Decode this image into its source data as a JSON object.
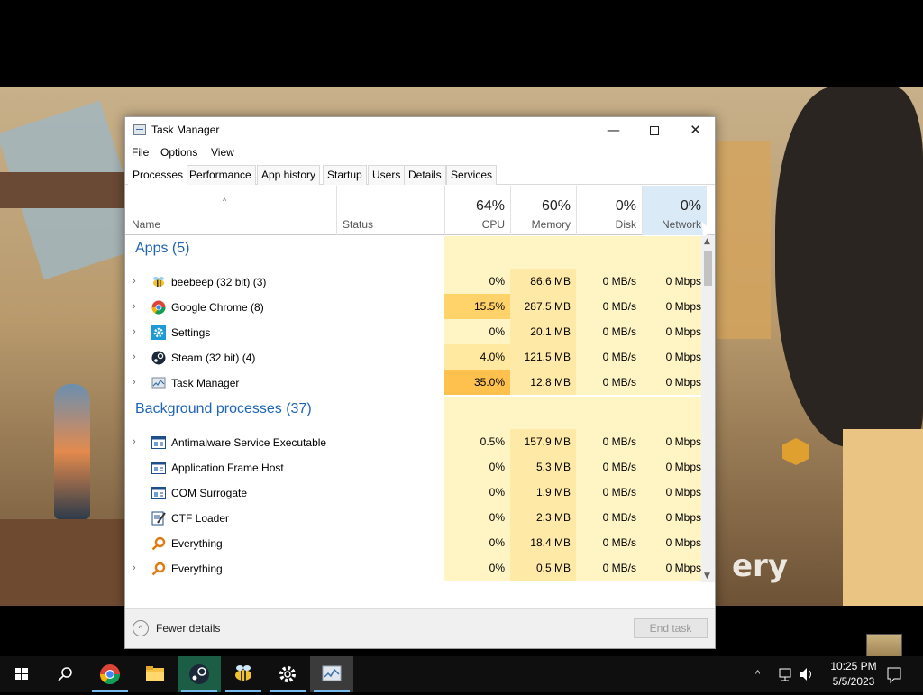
{
  "window": {
    "title": "Task Manager",
    "minimize_glyph": "—",
    "close_glyph": "✕"
  },
  "menu": [
    "File",
    "Options",
    "View"
  ],
  "tabs": [
    "Processes",
    "Performance",
    "App history",
    "Startup",
    "Users",
    "Details",
    "Services"
  ],
  "columns": {
    "name": "Name",
    "status": "Status",
    "cpu": {
      "percent": "64%",
      "label": "CPU"
    },
    "memory": {
      "percent": "60%",
      "label": "Memory"
    },
    "disk": {
      "percent": "0%",
      "label": "Disk"
    },
    "network": {
      "percent": "0%",
      "label": "Network"
    }
  },
  "groups": {
    "apps": "Apps (5)",
    "background": "Background processes (37)"
  },
  "apps": [
    {
      "name": "beebeep (32 bit) (3)",
      "cpu": "0%",
      "memory": "86.6 MB",
      "disk": "0 MB/s",
      "network": "0 Mbps",
      "icon": "bee-icon",
      "expandable": true
    },
    {
      "name": "Google Chrome (8)",
      "cpu": "15.5%",
      "memory": "287.5 MB",
      "disk": "0 MB/s",
      "network": "0 Mbps",
      "icon": "chrome-icon",
      "expandable": true
    },
    {
      "name": "Settings",
      "cpu": "0%",
      "memory": "20.1 MB",
      "disk": "0 MB/s",
      "network": "0 Mbps",
      "icon": "gear-icon",
      "expandable": true
    },
    {
      "name": "Steam (32 bit) (4)",
      "cpu": "4.0%",
      "memory": "121.5 MB",
      "disk": "0 MB/s",
      "network": "0 Mbps",
      "icon": "steam-icon",
      "expandable": true
    },
    {
      "name": "Task Manager",
      "cpu": "35.0%",
      "memory": "12.8 MB",
      "disk": "0 MB/s",
      "network": "0 Mbps",
      "icon": "task-manager-icon",
      "expandable": true
    }
  ],
  "background": [
    {
      "name": "Antimalware Service Executable",
      "cpu": "0.5%",
      "memory": "157.9 MB",
      "disk": "0 MB/s",
      "network": "0 Mbps",
      "icon": "service-window-icon",
      "expandable": true
    },
    {
      "name": "Application Frame Host",
      "cpu": "0%",
      "memory": "5.3 MB",
      "disk": "0 MB/s",
      "network": "0 Mbps",
      "icon": "service-window-icon",
      "expandable": false
    },
    {
      "name": "COM Surrogate",
      "cpu": "0%",
      "memory": "1.9 MB",
      "disk": "0 MB/s",
      "network": "0 Mbps",
      "icon": "service-window-icon",
      "expandable": false
    },
    {
      "name": "CTF Loader",
      "cpu": "0%",
      "memory": "2.3 MB",
      "disk": "0 MB/s",
      "network": "0 Mbps",
      "icon": "ctf-loader-icon",
      "expandable": false
    },
    {
      "name": "Everything",
      "cpu": "0%",
      "memory": "18.4 MB",
      "disk": "0 MB/s",
      "network": "0 Mbps",
      "icon": "magnifier-icon",
      "expandable": false
    },
    {
      "name": "Everything",
      "cpu": "0%",
      "memory": "0.5 MB",
      "disk": "0 MB/s",
      "network": "0 Mbps",
      "icon": "magnifier-icon",
      "expandable": true
    }
  ],
  "footer": {
    "fewer_details": "Fewer details",
    "end_task": "End task"
  },
  "wallpaper_text": "ery",
  "taskbar": {
    "apps": [
      "start-icon",
      "search-icon",
      "chrome-icon",
      "file-explorer-icon",
      "steam-icon",
      "bee-icon",
      "gear-icon",
      "task-manager-icon"
    ],
    "time": "10:25 PM",
    "date": "5/5/2023"
  },
  "colors": {
    "cpu_heat": {
      "low": "#fff4c4",
      "mid": "#ffe8a0",
      "high": "#ffd26a",
      "max": "#ffc14d"
    },
    "memory_heat": "#ffe9a6",
    "group_text": "#1e64b4",
    "network_header_highlight": "#dbeaf7"
  }
}
